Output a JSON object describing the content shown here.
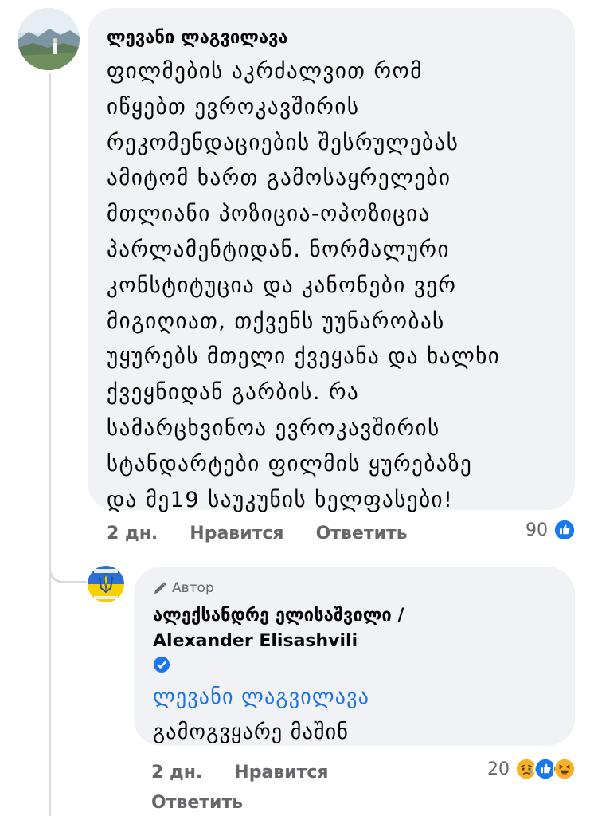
{
  "comment": {
    "author": "ლევანი ლაგვილავა",
    "text": "ფილმების  აკრძალვით რომ\nიწყებთ ევროკავშირის\nრეკომენდაციების შესრულებას\nამიტომ  ხართ გამოსაყრელები\nმთლიანი პოზიცია-ოპოზიცია\nპარლამენტიდან. ნორმალური\nკონსტიტუცია და კანონები ვერ\nმიგიღიათ, თქვენს უუნარობას\nუყურებს მთელი ქვეყანა და ხალხი\nქვეყნიდან გარბის. რა\nსამარცხვინოა ევროკავშირის\nსტანდარტები ფილმის ყურებაზე\nდა მე19 საუკუნის ხელფასები!",
    "time": "2 дн.",
    "like_label": "Нравится",
    "reply_label": "Ответить",
    "reaction_count": "90",
    "reaction_icons": [
      "like-reaction-icon"
    ]
  },
  "reply": {
    "badge_label": "Автор",
    "author_line1": "ალექსანდრე ელისაშვილი /",
    "author_line2": "Alexander Elisashvili",
    "mention": "ლევანი ლაგვილავა",
    "text": "გამოგვყარე მაშინ",
    "time": "2 дн.",
    "like_label": "Нравится",
    "reply_label": "Ответить",
    "reaction_count": "20",
    "reaction_icons": [
      "sad-reaction-icon",
      "like-reaction-icon",
      "haha-reaction-icon"
    ]
  },
  "colors": {
    "bubble": "#f0f2f5",
    "text": "#050505",
    "secondary": "#65676b",
    "link": "#1b74e4",
    "like_blue": "#1877f2",
    "reaction_yellow": "#f7b125"
  }
}
